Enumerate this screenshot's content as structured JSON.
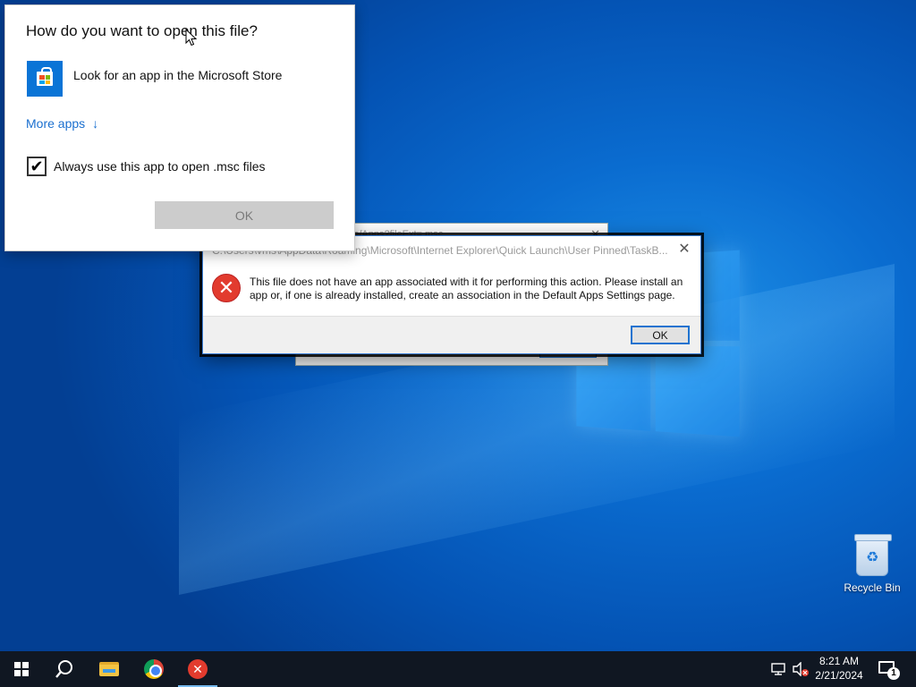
{
  "desktop": {
    "recycle_bin_label": "Recycle Bin"
  },
  "background_window": {
    "title_fragment": "...dows.store/Apps?fileExt=.msc"
  },
  "error_dialog": {
    "title": "C:\\Users\\vms\\AppData\\Roaming\\Microsoft\\Internet Explorer\\Quick Launch\\User Pinned\\TaskB...",
    "message": "This file does not have an app associated with it for performing this action. Please install an app or, if one is already installed, create an association in the Default Apps Settings page.",
    "ok_label": "OK",
    "icon": "error-icon"
  },
  "open_with": {
    "heading": "How do you want to open this file?",
    "store_label": "Look for an app in the Microsoft Store",
    "more_apps_label": "More apps",
    "more_apps_arrow": "↓",
    "always_use_label": "Always use this app to open .msc files",
    "always_use_checked": true,
    "ok_label": "OK"
  },
  "taskbar": {
    "items": [
      {
        "name": "start",
        "icon": "windows-start-icon"
      },
      {
        "name": "search",
        "icon": "search-icon"
      },
      {
        "name": "file-explorer",
        "icon": "folder-icon"
      },
      {
        "name": "chrome",
        "icon": "chrome-icon"
      },
      {
        "name": "error-app",
        "icon": "error-icon",
        "active": true
      }
    ],
    "time": "8:21 AM",
    "date": "2/21/2024",
    "notification_count": "1"
  },
  "colors": {
    "accent": "#0a74d6",
    "link": "#1a6fcf",
    "error_red": "#e23b2e",
    "taskbar": "#101722"
  }
}
